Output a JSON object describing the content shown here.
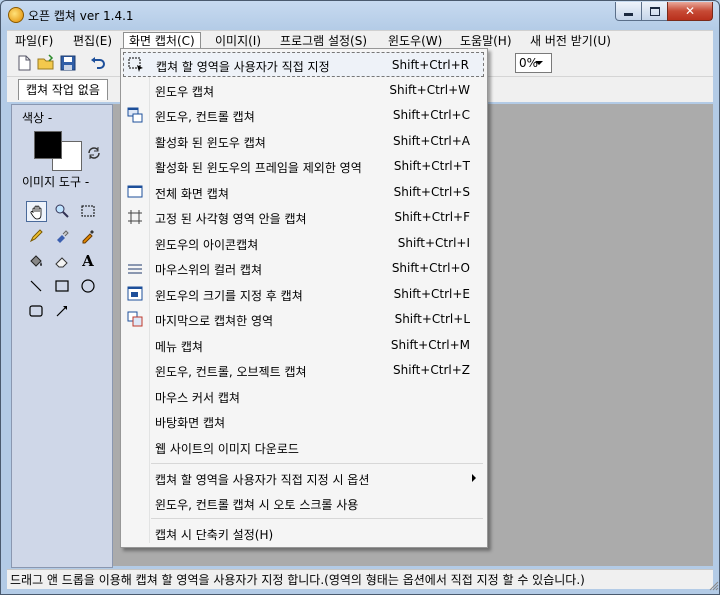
{
  "window": {
    "title": "오픈 캡쳐 ver 1.4.1"
  },
  "menubar": {
    "items": [
      {
        "label": "파일(F)"
      },
      {
        "label": "편집(E)"
      },
      {
        "label": "화면 캡처(C)"
      },
      {
        "label": "이미지(I)"
      },
      {
        "label": "프로그램 설정(S)"
      },
      {
        "label": "윈도우(W)"
      },
      {
        "label": "도움말(H)"
      },
      {
        "label": "새 버전 받기(U)"
      }
    ]
  },
  "toolbar": {
    "zoom_value": "0%"
  },
  "tabs": {
    "active": "캡쳐 작업 없음"
  },
  "left_panel": {
    "color_label": "색상 -",
    "tools_label": "이미지 도구 -",
    "tools": [
      "hand-icon",
      "zoom-icon",
      "marquee-icon",
      "pencil-icon",
      "eraser-brush-icon",
      "eyedropper-icon",
      "paint-bucket-icon",
      "eraser-icon",
      "text-icon",
      "line-icon",
      "rectangle-icon",
      "ellipse-icon",
      "rounded-rect-icon",
      "arrow-icon"
    ],
    "text_tool_glyph": "A"
  },
  "menu": {
    "items": [
      {
        "label": "캡쳐 할 영역을 사용자가 직접 지정",
        "shortcut": "Shift+Ctrl+R",
        "icon": "region-select-icon"
      },
      {
        "label": "윈도우 캡쳐",
        "shortcut": "Shift+Ctrl+W",
        "icon": ""
      },
      {
        "label": "윈도우, 컨트롤 캡쳐",
        "shortcut": "Shift+Ctrl+C",
        "icon": "window-control-icon"
      },
      {
        "label": "활성화 된 윈도우 캡쳐",
        "shortcut": "Shift+Ctrl+A",
        "icon": ""
      },
      {
        "label": "활성화 된 윈도우의 프레임을 제외한 영역",
        "shortcut": "Shift+Ctrl+T",
        "icon": ""
      },
      {
        "label": "전체 화면 캡쳐",
        "shortcut": "Shift+Ctrl+S",
        "icon": "fullscreen-icon"
      },
      {
        "label": "고정 된 사각형 영역 안을 캡쳐",
        "shortcut": "Shift+Ctrl+F",
        "icon": "fixed-rect-icon"
      },
      {
        "label": "윈도우의 아이콘캡쳐",
        "shortcut": "Shift+Ctrl+I",
        "icon": ""
      },
      {
        "label": "마우스위의 컬러 캡쳐",
        "shortcut": "Shift+Ctrl+O",
        "icon": "color-capture-icon"
      },
      {
        "label": "윈도우의 크기를 지정 후 캡쳐",
        "shortcut": "Shift+Ctrl+E",
        "icon": "resize-window-icon"
      },
      {
        "label": "마지막으로 캡쳐한 영역",
        "shortcut": "Shift+Ctrl+L",
        "icon": "last-region-icon"
      },
      {
        "label": "메뉴 캡쳐",
        "shortcut": "Shift+Ctrl+M",
        "icon": ""
      },
      {
        "label": "윈도우, 컨트롤, 오브젝트 캡쳐",
        "shortcut": "Shift+Ctrl+Z",
        "icon": ""
      },
      {
        "label": "마우스 커서 캡쳐",
        "shortcut": "",
        "icon": ""
      },
      {
        "label": "바탕화면 캡쳐",
        "shortcut": "",
        "icon": ""
      },
      {
        "label": "웹 사이트의 이미지 다운로드",
        "shortcut": "",
        "icon": ""
      },
      {
        "label": "캡쳐 할 영역을 사용자가 직접 지정 시 옵션",
        "shortcut": "",
        "icon": "",
        "submenu": true
      },
      {
        "label": "윈도우, 컨트롤 캡쳐 시 오토 스크롤 사용",
        "shortcut": "",
        "icon": ""
      },
      {
        "label": "캡쳐 시 단축키 설정(H)",
        "shortcut": "",
        "icon": ""
      }
    ]
  },
  "statusbar": {
    "text": "드래그 앤 드롭을 이용해 캡쳐 할 영역을 사용자가 지정 합니다.(영역의 형태는 옵션에서 직접 지정 할 수 있습니다.)"
  }
}
